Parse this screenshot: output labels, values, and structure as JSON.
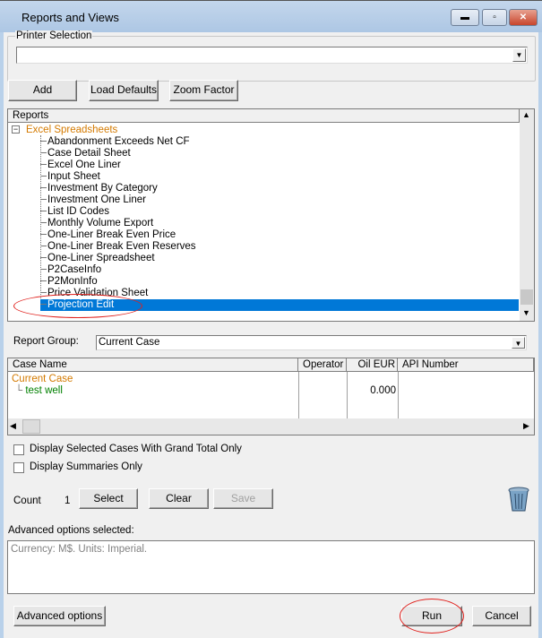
{
  "window": {
    "title": "Reports and Views",
    "minimize": "▬",
    "maximize": "▫",
    "close": "✕"
  },
  "printer": {
    "legend": "Printer Selection",
    "value": ""
  },
  "toolbar": {
    "add": "Add",
    "load_defaults": "Load Defaults",
    "zoom_factor": "Zoom Factor"
  },
  "reports": {
    "header": "Reports",
    "group": "Excel Spreadsheets",
    "items": [
      "Abandonment Exceeds Net CF",
      "Case Detail Sheet",
      "Excel One Liner",
      "Input Sheet",
      "Investment By Category",
      "Investment One Liner",
      "List ID Codes",
      "Monthly Volume Export",
      "One-Liner Break Even Price",
      "One-Liner Break Even Reserves",
      "One-Liner Spreadsheet",
      "P2CaseInfo",
      "P2MonInfo",
      "Price Validation Sheet",
      "Projection Edit"
    ],
    "selected": "Projection Edit"
  },
  "report_group": {
    "label": "Report Group:",
    "value": "Current Case"
  },
  "cases": {
    "columns": [
      "Case Name",
      "Operator",
      "Oil EUR",
      "API Number"
    ],
    "group": "Current Case",
    "rows": [
      {
        "name": "test well",
        "operator": "",
        "oil_eur": "0.000",
        "api": ""
      }
    ]
  },
  "options": {
    "grand_total": "Display Selected Cases With Grand Total Only",
    "summaries_only": "Display Summaries Only"
  },
  "count": {
    "label": "Count",
    "value": "1",
    "select": "Select",
    "clear": "Clear",
    "save": "Save"
  },
  "advanced": {
    "label": "Advanced options selected:",
    "text": "Currency: M$.  Units: Imperial."
  },
  "footer": {
    "advanced_options": "Advanced options",
    "run": "Run",
    "cancel": "Cancel"
  },
  "colors": {
    "group": "#d47a00",
    "case_child": "#008000",
    "selection": "#0078d7",
    "annotation": "#e0201c"
  }
}
